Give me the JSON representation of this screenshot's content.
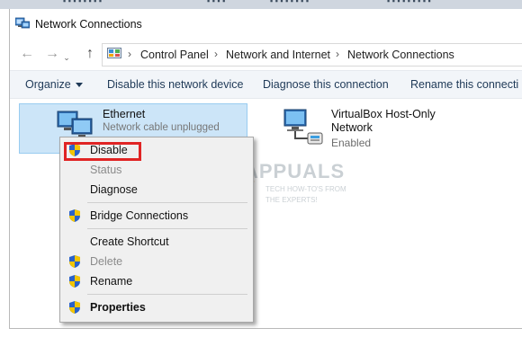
{
  "window": {
    "title": "Network Connections"
  },
  "nav": {
    "back_icon": "arrow-left-icon",
    "forward_icon": "arrow-right-icon",
    "up_icon": "arrow-up-icon"
  },
  "breadcrumb": [
    "Control Panel",
    "Network and Internet",
    "Network Connections"
  ],
  "toolbar": {
    "organize": "Organize",
    "disable": "Disable this network device",
    "diagnose": "Diagnose this connection",
    "rename": "Rename this connecti"
  },
  "adapters": [
    {
      "name": "Ethernet",
      "status": "Network cable unplugged"
    },
    {
      "name": "VirtualBox Host-Only Network",
      "status": "Enabled"
    }
  ],
  "context_menu": {
    "disable": "Disable",
    "status": "Status",
    "diagnose": "Diagnose",
    "bridge": "Bridge Connections",
    "shortcut": "Create Shortcut",
    "delete": "Delete",
    "rename": "Rename",
    "properties": "Properties"
  },
  "watermark": {
    "brand": "APPUALS",
    "tagline1": "TECH HOW-TO'S FROM",
    "tagline2": "THE EXPERTS!"
  },
  "colors": {
    "selection": "#cce5f8",
    "highlight_border": "#e02424",
    "command_text": "#1e3957"
  }
}
